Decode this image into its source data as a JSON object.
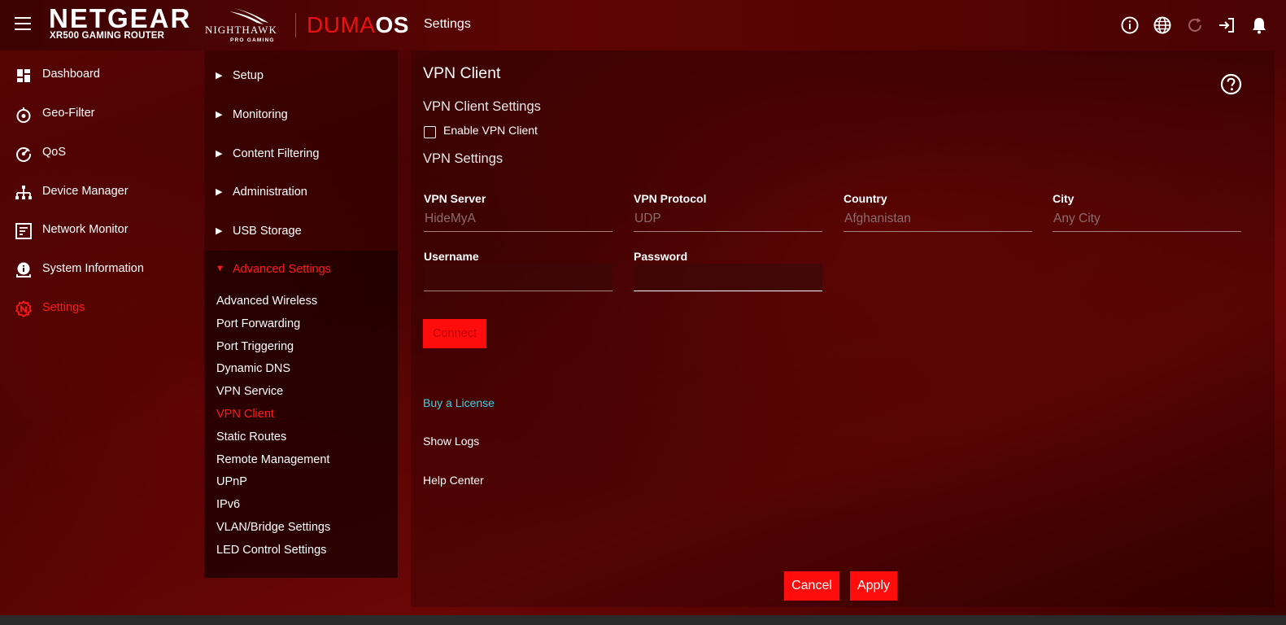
{
  "header": {
    "brand": "NETGEAR",
    "model": "XR500 GAMING ROUTER",
    "nighthawk": "NIGHTHAWK",
    "nighthawk_sub": "PRO GAMING",
    "os_prefix": "DUMA",
    "os_suffix": "OS",
    "title": "Settings",
    "icons": [
      "info-icon",
      "globe-icon",
      "refresh-icon",
      "logout-icon",
      "bell-icon"
    ]
  },
  "sidebar": {
    "items": [
      {
        "label": "Dashboard",
        "icon": "dashboard-icon"
      },
      {
        "label": "Geo-Filter",
        "icon": "geo-filter-icon"
      },
      {
        "label": "QoS",
        "icon": "qos-icon"
      },
      {
        "label": "Device Manager",
        "icon": "device-manager-icon"
      },
      {
        "label": "Network Monitor",
        "icon": "network-monitor-icon"
      },
      {
        "label": "System Information",
        "icon": "system-info-icon"
      },
      {
        "label": "Settings",
        "icon": "settings-icon",
        "active": true
      }
    ]
  },
  "subnav": {
    "sections": [
      "Setup",
      "Monitoring",
      "Content Filtering",
      "Administration",
      "USB Storage",
      "Advanced Settings"
    ],
    "open_section": "Advanced Settings",
    "advanced_items": [
      "Advanced Wireless",
      "Port Forwarding",
      "Port Triggering",
      "Dynamic DNS",
      "VPN Service",
      "VPN Client",
      "Static Routes",
      "Remote Management",
      "UPnP",
      "IPv6",
      "VLAN/Bridge Settings",
      "LED Control Settings"
    ],
    "current_item": "VPN Client"
  },
  "main": {
    "title": "VPN Client",
    "client_settings_heading": "VPN Client Settings",
    "enable_label": "Enable VPN Client",
    "enable_checked": false,
    "vpn_settings_heading": "VPN Settings",
    "fields": {
      "server_label": "VPN Server",
      "server_value": "HideMyA",
      "protocol_label": "VPN Protocol",
      "protocol_value": "UDP",
      "country_label": "Country",
      "country_value": "Afghanistan",
      "city_label": "City",
      "city_value": "Any City",
      "username_label": "Username",
      "username_value": "",
      "password_label": "Password",
      "password_value": ""
    },
    "connect_label": "Connect",
    "links": {
      "buy": "Buy a License",
      "logs": "Show Logs",
      "help": "Help Center"
    },
    "cancel_label": "Cancel",
    "apply_label": "Apply"
  },
  "colors": {
    "accent": "#ff0d0d",
    "active_text": "#ff1a1a",
    "link": "#3ad0e6",
    "background": "#4a0202"
  }
}
